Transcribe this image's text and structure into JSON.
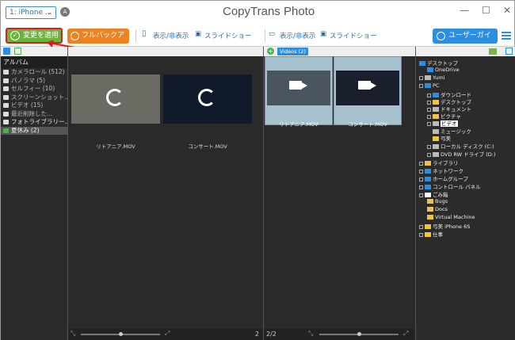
{
  "titlebar": {
    "device": "1: iPhone ...",
    "device_badge": "A",
    "app_title": "CopyTrans Photo"
  },
  "toolbar": {
    "apply_label": "変更を適用",
    "backup_label": "フルバックアップ",
    "left_toggle": "表示/非表示",
    "left_slideshow": "スライドショー",
    "right_toggle": "表示/非表示",
    "right_slideshow": "スライドショー",
    "guide_label": "ユーザーガイド"
  },
  "albums": {
    "title": "アルバム",
    "items": [
      {
        "label": "カメラロール (512)"
      },
      {
        "label": "パノラマ (5)"
      },
      {
        "label": "セルフィー (10)"
      },
      {
        "label": "スクリーンショット..."
      },
      {
        "label": "ビデオ (15)"
      },
      {
        "label": "最近削除した..."
      },
      {
        "label": "フォトライブラリー..."
      },
      {
        "label": "夏休み (2)"
      }
    ]
  },
  "iphone_panel": {
    "items": [
      {
        "caption": "リトアニア.MOV"
      },
      {
        "caption": "コンサート.MOV"
      }
    ],
    "footer_count": "2"
  },
  "pc_panel": {
    "tab_label": "Videos (2)",
    "items": [
      {
        "caption": "リトアニア.MOV"
      },
      {
        "caption": "コンサート.MOV"
      }
    ],
    "footer_count": "2/2"
  },
  "tree": {
    "items": [
      {
        "label": "デスクトップ"
      },
      {
        "label": "OneDrive"
      },
      {
        "label": "Yumi"
      },
      {
        "label": "PC"
      },
      {
        "label": "ダウンロード"
      },
      {
        "label": "デスクトップ"
      },
      {
        "label": "ドキュメント"
      },
      {
        "label": "ピクチャ"
      },
      {
        "label": "ビデオ"
      },
      {
        "label": "ミュージック"
      },
      {
        "label": "弓美"
      },
      {
        "label": "ローカル ディスク (C:)"
      },
      {
        "label": "DVD RW ドライブ (D:)"
      },
      {
        "label": "ライブラリ"
      },
      {
        "label": "ネットワーク"
      },
      {
        "label": "ホームグループ"
      },
      {
        "label": "コントロール パネル"
      },
      {
        "label": "ごみ箱"
      },
      {
        "label": "Bugs"
      },
      {
        "label": "Docs"
      },
      {
        "label": "Virtual Machine"
      },
      {
        "label": "弓美 iPhone 6S"
      },
      {
        "label": "仕事"
      }
    ]
  }
}
